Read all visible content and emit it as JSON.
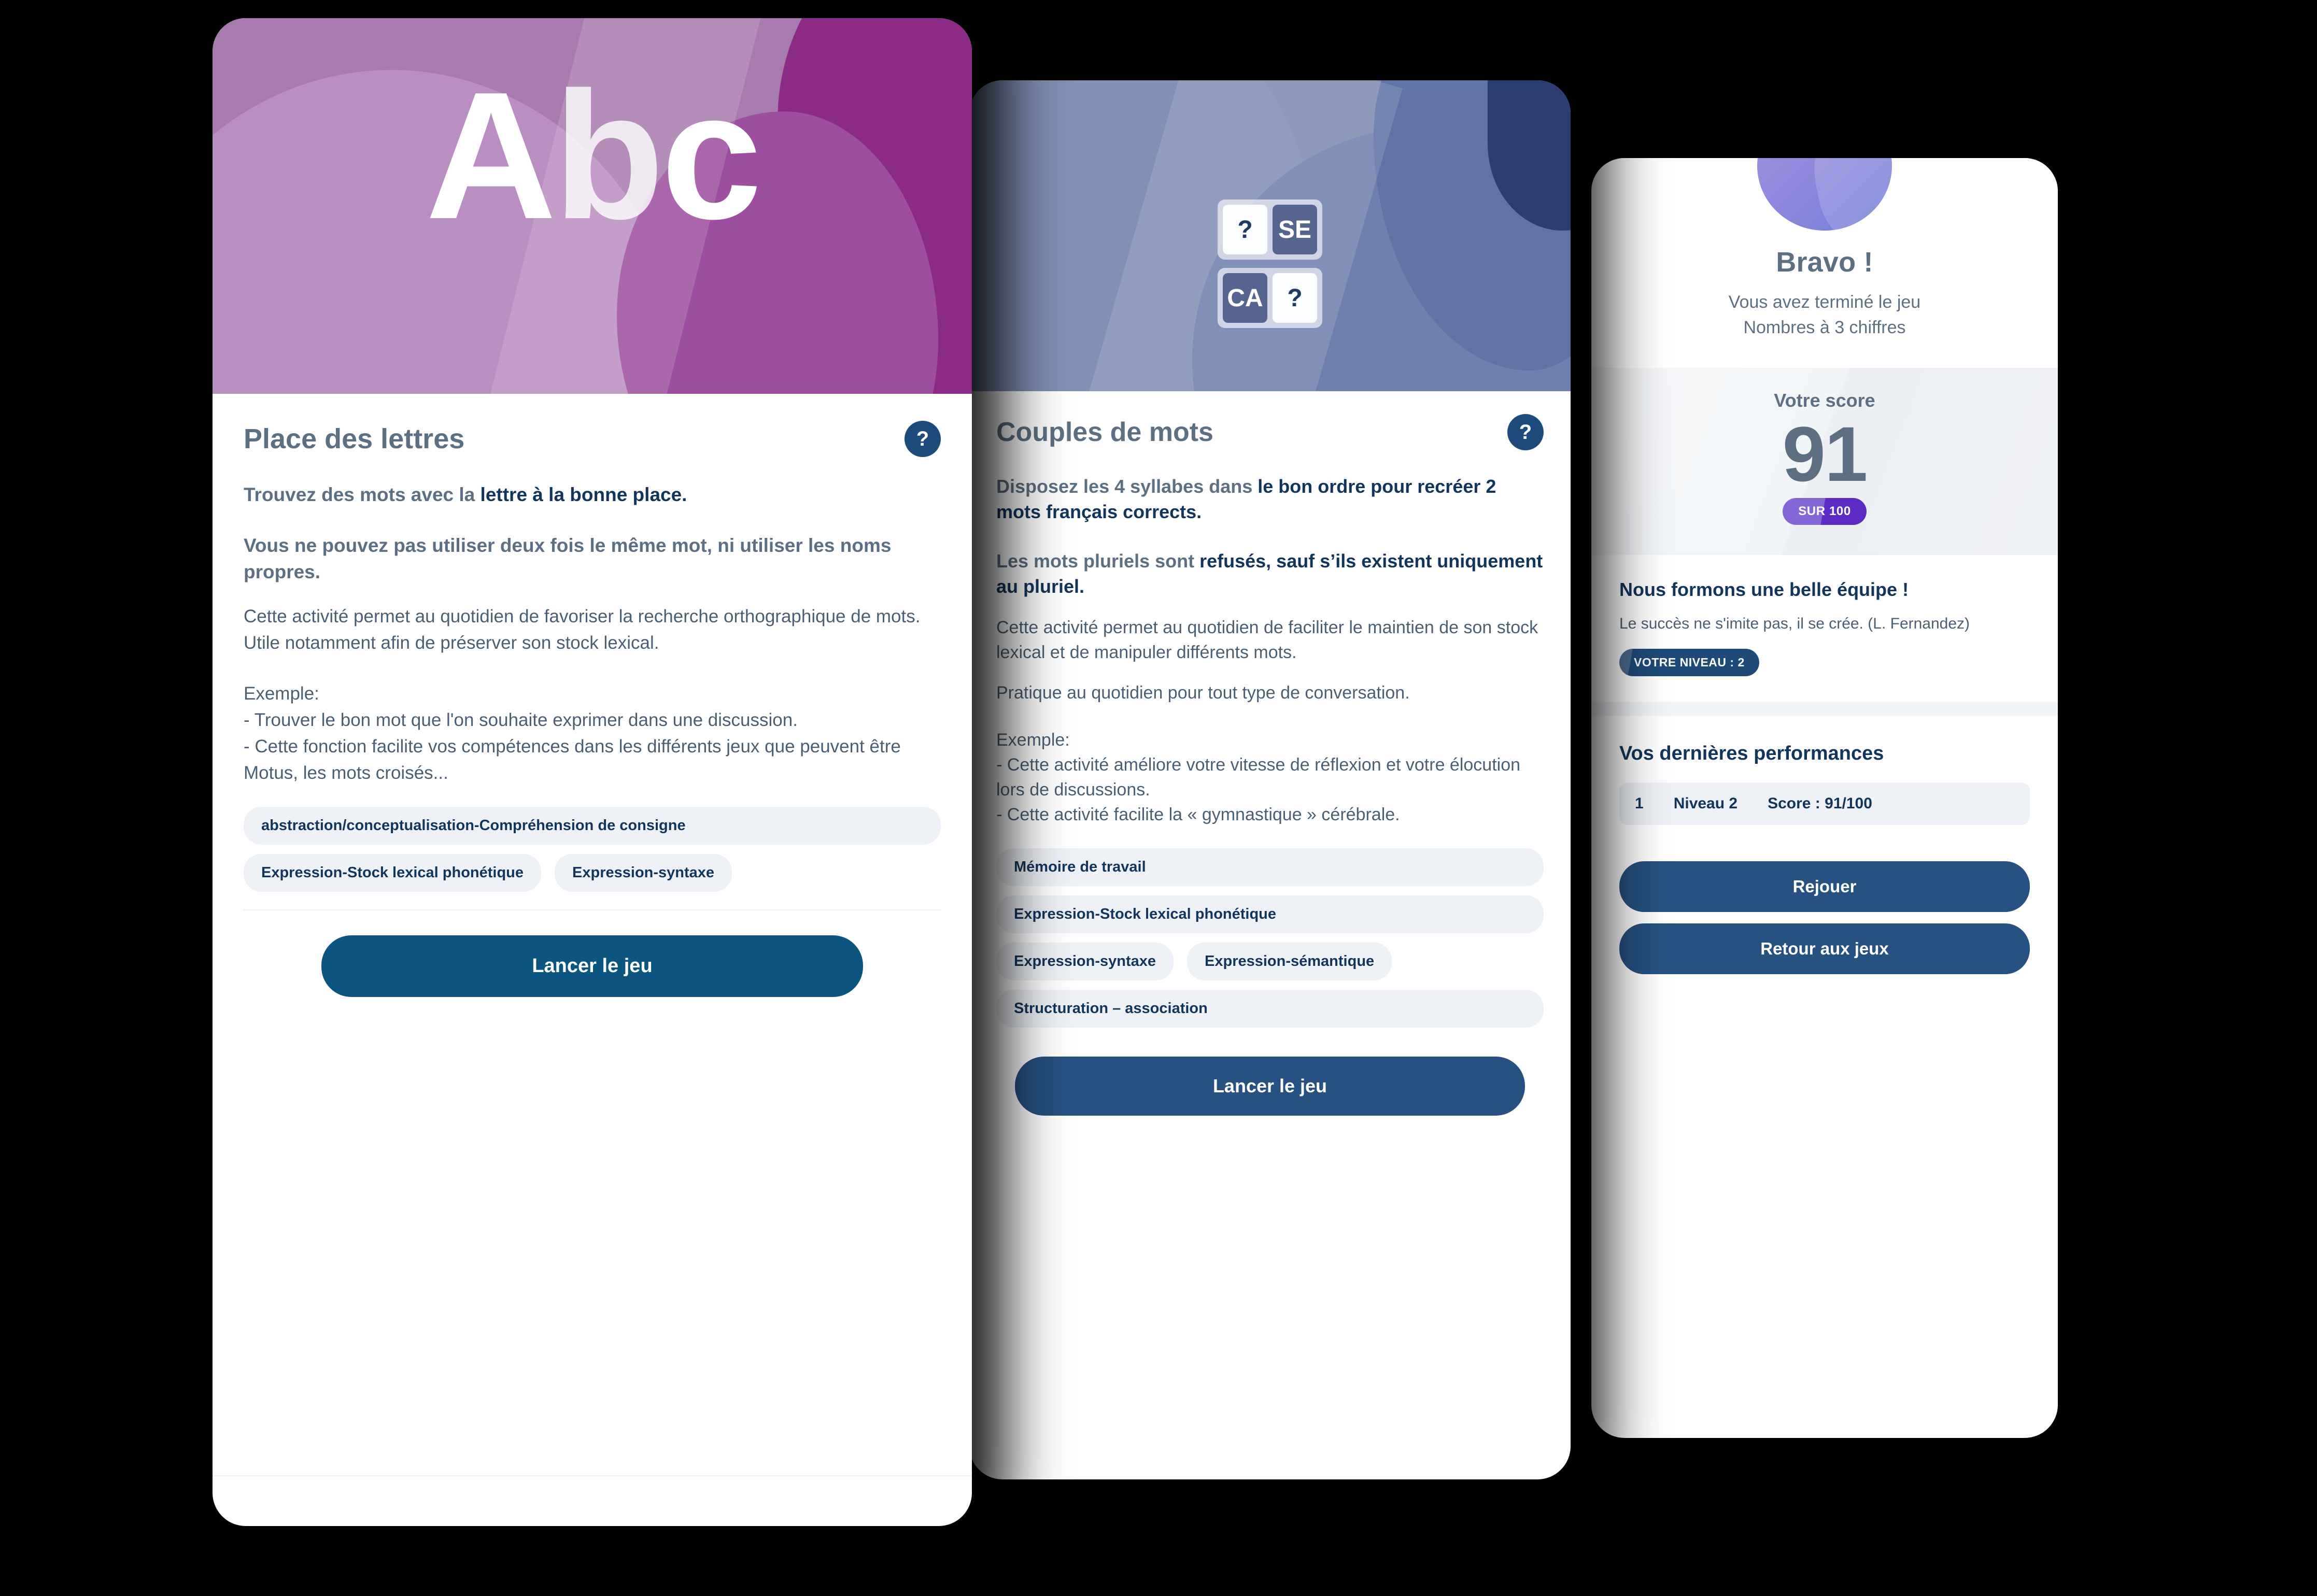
{
  "card_lettres": {
    "hero": {
      "logo_text_a": "A",
      "logo_text_b": "b",
      "logo_text_c": "c"
    },
    "title": "Place des lettres",
    "help_icon": "?",
    "lead_1_normal": "Trouvez des mots avec la ",
    "lead_1_bold": "lettre à la bonne place.",
    "lead_2_normal": "Vous ne pouvez pas utiliser deux fois le même mot, ni utiliser les noms propres.",
    "para_1": "Cette activité permet au quotidien de favoriser la recherche orthographique de mots.",
    "para_2": "Utile notamment afin de préserver son stock lexical.",
    "example_title": "Exemple:",
    "example_1": "- Trouver le bon mot que l'on souhaite exprimer dans une discussion.",
    "example_2": "- Cette fonction facilite vos compétences dans les différents jeux que peuvent être Motus, les mots croisés...",
    "chips": [
      "abstraction/conceptualisation-Compréhension de consigne",
      "Expression-Stock lexical phonétique",
      "Expression-syntaxe"
    ],
    "launch_label": "Lancer le jeu"
  },
  "card_couples": {
    "hero": {
      "tiles_row_1": [
        "?",
        "SE"
      ],
      "tiles_row_2": [
        "CA",
        "?"
      ]
    },
    "title": "Couples de mots",
    "help_icon": "?",
    "lead_1_normal": "Disposez les 4 syllabes dans ",
    "lead_1_bold": "le bon ordre pour recréer 2 mots français corrects.",
    "lead_2_normal": "Les mots pluriels sont ",
    "lead_2_bold": "refusés, sauf s’ils existent uniquement au pluriel.",
    "para_1": "Cette activité permet au quotidien de faciliter le maintien de son stock lexical et de manipuler différents mots.",
    "para_2": "Pratique au quotidien pour tout type de conversation.",
    "example_title": "Exemple:",
    "example_1": "- Cette activité améliore votre vitesse de réflexion et votre élocution lors de discussions.",
    "example_2": "- Cette activité facilite la « gymnastique » cérébrale.",
    "chips": [
      "Mémoire de travail",
      "Expression-Stock lexical phonétique",
      "Expression-syntaxe",
      "Expression-sémantique",
      "Structuration – association"
    ],
    "launch_label": "Lancer le jeu"
  },
  "card_resultat": {
    "avatar": "avatar-blob",
    "bravo": "Bravo !",
    "subtitle_line_1": "Vous avez terminé le jeu",
    "subtitle_line_2": "Nombres à 3 chiffres",
    "score_label": "Votre score",
    "score_value": "91",
    "score_pill": "SUR 100",
    "quote_title": "Nous formons une belle équipe !",
    "quote_text": "Le succès ne s'imite pas, il se crée. (L. Fernandez)",
    "level_badge": "VOTRE NIVEAU : 2",
    "performances_title": "Vos dernières performances",
    "performance_row": {
      "date": "1",
      "level": "Niveau 2",
      "score": "Score : 91/100"
    },
    "replay_label": "Rejouer",
    "back_label": "Retour aux jeux"
  },
  "colors": {
    "brand_blue_dark": "#12355b",
    "brand_blue": "#265181",
    "brand_blue_deep": "#0b5580",
    "text_muted": "#5d7083",
    "text_body": "#4a5f73",
    "chip_bg": "#eef2f7",
    "purple_hero": "#a87bae",
    "blue_hero": "#7d8cb0",
    "pill_purple": "#5b2bc4"
  }
}
